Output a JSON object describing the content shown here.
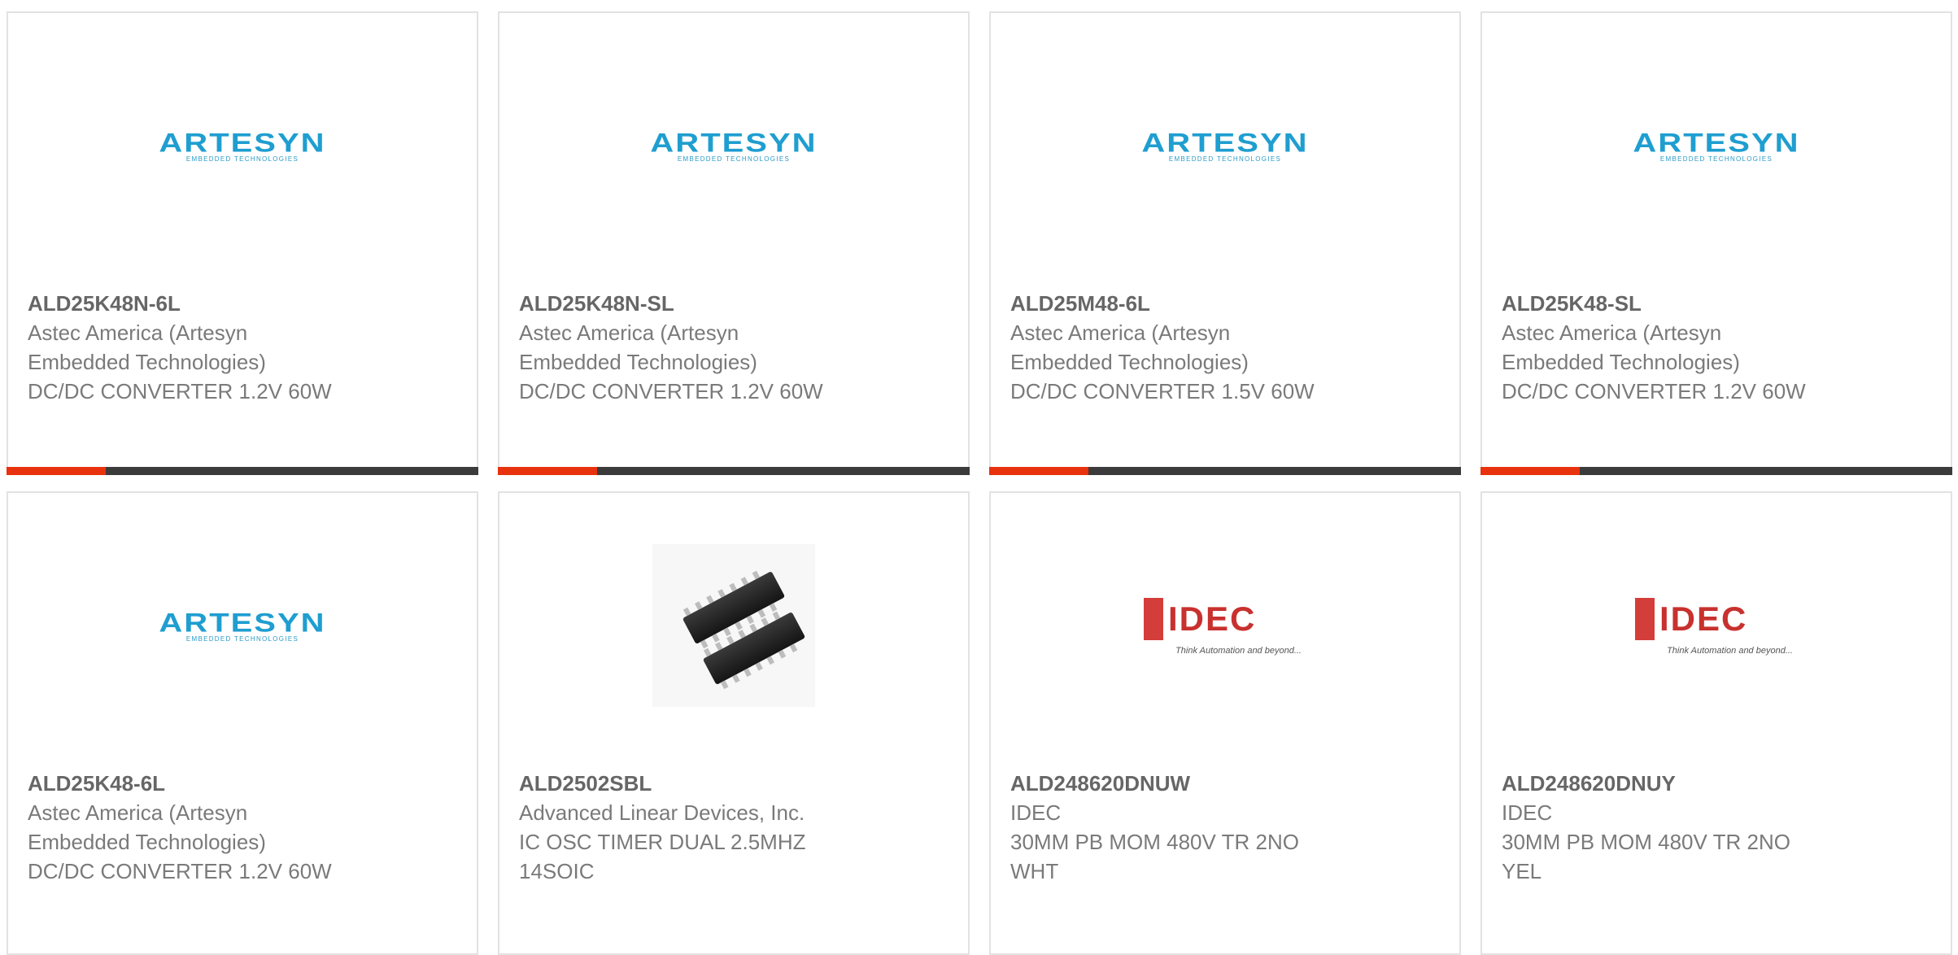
{
  "brand_colors": {
    "accent": "#e8320e",
    "bar": "#3b3b3b",
    "artesyn": "#1f9ed0",
    "idec": "#c8312e"
  },
  "products": [
    {
      "part_number": "ALD25K48N-6L",
      "manufacturer": "Astec America (Artesyn Embedded Technologies)",
      "description": "DC/DC CONVERTER 1.2V 60W",
      "image": "artesyn-logo",
      "logo_text": "ARTESYN",
      "logo_tagline": "EMBEDDED TECHNOLOGIES",
      "progress": 0.21
    },
    {
      "part_number": "ALD25K48N-SL",
      "manufacturer": "Astec America (Artesyn Embedded Technologies)",
      "description": "DC/DC CONVERTER 1.2V 60W",
      "image": "artesyn-logo",
      "logo_text": "ARTESYN",
      "logo_tagline": "EMBEDDED TECHNOLOGIES",
      "progress": 0.21
    },
    {
      "part_number": "ALD25M48-6L",
      "manufacturer": "Astec America (Artesyn Embedded Technologies)",
      "description": "DC/DC CONVERTER 1.5V 60W",
      "image": "artesyn-logo",
      "logo_text": "ARTESYN",
      "logo_tagline": "EMBEDDED TECHNOLOGIES",
      "progress": 0.21
    },
    {
      "part_number": "ALD25K48-SL",
      "manufacturer": "Astec America (Artesyn Embedded Technologies)",
      "description": "DC/DC CONVERTER 1.2V 60W",
      "image": "artesyn-logo",
      "logo_text": "ARTESYN",
      "logo_tagline": "EMBEDDED TECHNOLOGIES",
      "progress": 0.21
    },
    {
      "part_number": "ALD25K48-6L",
      "manufacturer": "Astec America (Artesyn Embedded Technologies)",
      "description": "DC/DC CONVERTER 1.2V 60W",
      "image": "artesyn-logo",
      "logo_text": "ARTESYN",
      "logo_tagline": "EMBEDDED TECHNOLOGIES"
    },
    {
      "part_number": "ALD2502SBL",
      "manufacturer": "Advanced Linear Devices, Inc.",
      "description": "IC OSC TIMER DUAL 2.5MHZ 14SOIC",
      "image": "soic-chip-photo"
    },
    {
      "part_number": "ALD248620DNUW",
      "manufacturer": "IDEC",
      "description": "30MM PB MOM 480V TR 2NO WHT",
      "image": "idec-logo",
      "logo_text": "IDEC",
      "logo_tagline": "Think Automation and beyond..."
    },
    {
      "part_number": "ALD248620DNUY",
      "manufacturer": "IDEC",
      "description": "30MM PB MOM 480V TR 2NO YEL",
      "image": "idec-logo",
      "logo_text": "IDEC",
      "logo_tagline": "Think Automation and beyond..."
    }
  ]
}
